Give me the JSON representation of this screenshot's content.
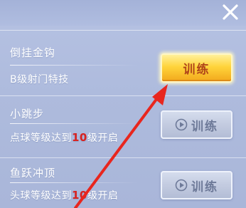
{
  "close": {
    "icon": "close-icon"
  },
  "skills": [
    {
      "name": "倒挂金钩",
      "desc": "B级射门特技",
      "button_label": "训练",
      "state": "unlocked"
    },
    {
      "name": "小跳步",
      "desc_prefix": "点球等级达到",
      "desc_level": "10",
      "desc_suffix": "级开启",
      "button_label": "训练",
      "state": "locked",
      "button_icon": "play-icon"
    },
    {
      "name": "鱼跃冲顶",
      "desc_prefix": "头球等级达到",
      "desc_level": "10",
      "desc_suffix": "级开启",
      "button_label": "训练",
      "state": "locked",
      "button_icon": "play-icon"
    }
  ],
  "annotation": {
    "type": "red-arrow",
    "points_to": "train-button-1",
    "color": "#e8261e"
  },
  "colors": {
    "background": "#aebbdd",
    "active_button": "#ffd43b",
    "active_text": "#b0451a",
    "locked_button": "#c3cbe0",
    "level_highlight": "#d9221f"
  }
}
